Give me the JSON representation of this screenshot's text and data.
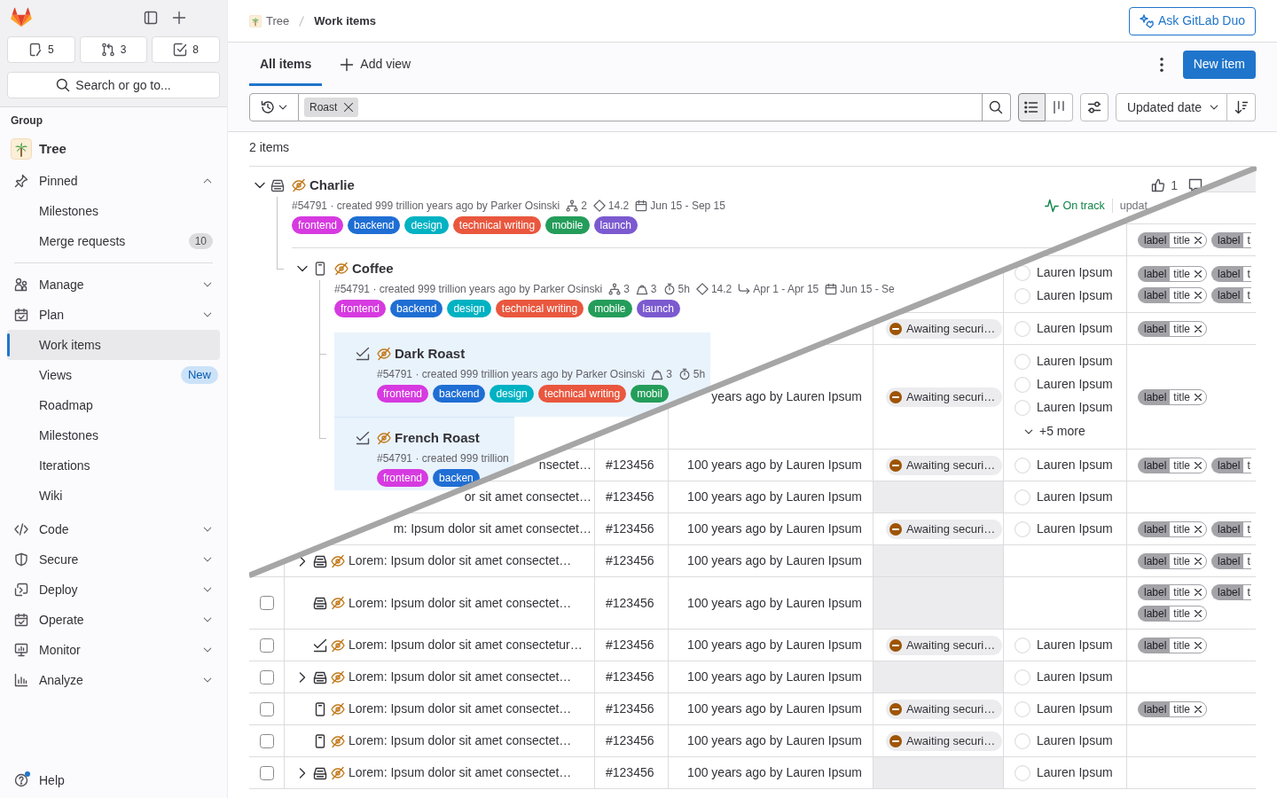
{
  "sidebar": {
    "counters": [
      {
        "kind": "issues",
        "count": "5"
      },
      {
        "kind": "merge_requests",
        "count": "3"
      },
      {
        "kind": "todos",
        "count": "8"
      }
    ],
    "search_button": "Search or go to...",
    "context_heading": "Group",
    "context": "Tree",
    "nav": [
      {
        "kind": "pinned",
        "label": "Pinned",
        "expanded": true,
        "items": [
          {
            "label": "Milestones",
            "selected": false
          },
          {
            "label": "Merge requests",
            "count": "10",
            "selected": false
          }
        ]
      },
      {
        "kind": "manage",
        "label": "Manage",
        "expanded": false
      },
      {
        "kind": "plan",
        "label": "Plan",
        "expanded": false,
        "items": [
          {
            "label": "Work items",
            "selected": true
          },
          {
            "label": "Views",
            "badge": "New",
            "selected": false
          },
          {
            "label": "Roadmap",
            "selected": false
          },
          {
            "label": "Milestones",
            "selected": false
          },
          {
            "label": "Iterations",
            "selected": false
          },
          {
            "label": "Wiki",
            "selected": false
          }
        ]
      },
      {
        "kind": "code",
        "label": "Code",
        "expanded": false
      },
      {
        "kind": "secure",
        "label": "Secure",
        "expanded": false
      },
      {
        "kind": "deploy",
        "label": "Deploy",
        "expanded": false
      },
      {
        "kind": "operate",
        "label": "Operate",
        "expanded": false
      },
      {
        "kind": "monitor",
        "label": "Monitor",
        "expanded": false
      },
      {
        "kind": "analyze",
        "label": "Analyze",
        "expanded": false
      }
    ],
    "help": {
      "label": "Help",
      "unread": true
    }
  },
  "header": {
    "breadcrumb": [
      {
        "kind": "group",
        "label": "Tree",
        "current": false
      },
      {
        "kind": "page",
        "label": "Work items",
        "current": true
      }
    ],
    "duo_button": "Ask GitLab Duo"
  },
  "tabs": [
    {
      "label": "All items",
      "selected": true
    }
  ],
  "add_view": "Add view",
  "new_button": "New item",
  "filter": {
    "token": "Roast"
  },
  "view_toggle": [
    {
      "kind": "list",
      "selected": true
    },
    {
      "kind": "board",
      "selected": false
    }
  ],
  "sort": {
    "label": "Updated date"
  },
  "count": "2 items",
  "list": [
    {
      "kind": "epic",
      "title": "Charlie",
      "confidential": true,
      "expanded": true,
      "selected": false,
      "meta": "#54791 · created 999 trillion years ago by Parker Osinski",
      "stats": [
        {
          "kind": "children",
          "text": "2"
        },
        {
          "kind": "milestone",
          "text": "14.2"
        },
        {
          "kind": "dates",
          "text": "Jun 15 - Sep 15"
        }
      ],
      "labels": [
        {
          "text": "frontend",
          "color": "#d63ae0"
        },
        {
          "text": "backend",
          "color": "#1f6ed4"
        },
        {
          "text": "design",
          "color": "#00b2c2"
        },
        {
          "text": "technical writing",
          "color": "#e9573e"
        },
        {
          "text": "mobile",
          "color": "#249d5a"
        },
        {
          "text": "launch",
          "color": "#7b5ad0"
        }
      ],
      "upvotes": "1",
      "health": "On track",
      "updated": "updat",
      "children": [
        {
          "kind": "issue",
          "title": "Coffee",
          "confidential": true,
          "expanded": true,
          "selected": false,
          "meta": "#54791 · created 999 trillion years ago by Parker Osinski",
          "stats": [
            {
              "kind": "children",
              "text": "3"
            },
            {
              "kind": "weight",
              "text": "3"
            },
            {
              "kind": "time",
              "text": "5h"
            },
            {
              "kind": "milestone",
              "text": "14.2"
            },
            {
              "kind": "iteration",
              "text": "Apr 1 - Apr 15"
            },
            {
              "kind": "dates",
              "text": "Jun 15 - Se"
            }
          ],
          "labels": [
            {
              "text": "frontend",
              "color": "#d63ae0"
            },
            {
              "text": "backend",
              "color": "#1f6ed4"
            },
            {
              "text": "design",
              "color": "#00b2c2"
            },
            {
              "text": "technical writing",
              "color": "#e9573e"
            },
            {
              "text": "mobile",
              "color": "#249d5a"
            },
            {
              "text": "launch",
              "color": "#7b5ad0"
            }
          ],
          "children": [
            {
              "kind": "task",
              "title": "Dark Roast",
              "confidential": true,
              "selected": true,
              "meta": "#54791 · created 999 trillion years ago by Parker Osinski",
              "stats": [
                {
                  "kind": "weight",
                  "text": "3"
                },
                {
                  "kind": "time",
                  "text": "5h"
                }
              ],
              "labels": [
                {
                  "text": "frontend",
                  "color": "#d63ae0"
                },
                {
                  "text": "backend",
                  "color": "#1f6ed4"
                },
                {
                  "text": "design",
                  "color": "#00b2c2"
                },
                {
                  "text": "technical writing",
                  "color": "#e9573e"
                },
                {
                  "text": "mobil",
                  "color": "#249d5a"
                }
              ]
            },
            {
              "kind": "task",
              "title": "French Roast",
              "confidential": true,
              "selected": true,
              "meta": "#54791 · created 999 trillion",
              "labels": [
                {
                  "text": "frontend",
                  "color": "#d63ae0"
                },
                {
                  "text": "backen",
                  "color": "#1f6ed4"
                }
              ]
            }
          ]
        }
      ]
    }
  ],
  "table": {
    "rows": [
      {
        "labels": [
          [
            {
              "key": "label",
              "value": "title",
              "removable": true
            },
            {
              "key": "label",
              "value": "t",
              "removable": false
            }
          ]
        ]
      },
      {
        "assignees": [
          "Lauren Ipsum",
          "Lauren Ipsum"
        ],
        "labels": [
          [
            {
              "key": "label",
              "value": "title",
              "removable": true
            },
            {
              "key": "label",
              "value": "t",
              "removable": false
            }
          ],
          [
            {
              "key": "label",
              "value": "title",
              "removable": true
            },
            {
              "key": "label",
              "value": "t",
              "removable": false
            }
          ]
        ]
      },
      {
        "status": "Awaiting securi…",
        "assignees": [
          "Lauren Ipsum"
        ],
        "labels": [
          [
            {
              "key": "label",
              "value": "title",
              "removable": true
            }
          ]
        ]
      },
      {
        "created": "years ago by Lauren Ipsum",
        "status": "Awaiting securi…",
        "assignees": [
          "Lauren Ipsum",
          "Lauren Ipsum",
          "Lauren Ipsum"
        ],
        "more": "+5 more",
        "labels": [
          [
            {
              "key": "label",
              "value": "title",
              "removable": true
            }
          ]
        ]
      },
      {
        "title": "nsectet…",
        "id": "#123456",
        "created": "100 years ago by Lauren Ipsum",
        "status": "Awaiting securi…",
        "assignees": [
          "Lauren Ipsum"
        ],
        "labels": [
          [
            {
              "key": "label",
              "value": "title",
              "removable": true
            },
            {
              "key": "label",
              "value": "t",
              "removable": false
            }
          ]
        ]
      },
      {
        "title": "or sit amet consectet…",
        "id": "#123456",
        "created": "100 years ago by Lauren Ipsum",
        "assignees": [
          "Lauren Ipsum"
        ]
      },
      {
        "title": "m: Ipsum dolor sit amet consectet…",
        "id": "#123456",
        "created": "100 years ago by Lauren Ipsum",
        "status": "Awaiting securi…",
        "assignees": [
          "Lauren Ipsum"
        ],
        "labels": [
          [
            {
              "key": "label",
              "value": "title",
              "removable": true
            },
            {
              "key": "label",
              "value": "t",
              "removable": false
            }
          ]
        ]
      },
      {
        "kind": "epic",
        "expanded": false,
        "confidential": true,
        "title": "Lorem: Ipsum dolor sit amet consectet…",
        "id": "#123456",
        "created": "100 years ago by Lauren Ipsum",
        "labels": [
          [
            {
              "key": "label",
              "value": "title",
              "removable": true
            },
            {
              "key": "label",
              "value": "t",
              "removable": false
            }
          ]
        ]
      },
      {
        "checked": false,
        "kind": "epic",
        "confidential": true,
        "title": "Lorem: Ipsum dolor sit amet consectet…",
        "id": "#123456",
        "created": "100 years ago by Lauren Ipsum",
        "labels": [
          [
            {
              "key": "label",
              "value": "title",
              "removable": true
            },
            {
              "key": "label",
              "value": "t",
              "removable": false
            }
          ],
          [
            {
              "key": "label",
              "value": "title",
              "removable": true
            }
          ]
        ]
      },
      {
        "checked": false,
        "kind": "task",
        "confidential": true,
        "title": "Lorem: Ipsum dolor sit amet consectetur…",
        "id": "#123456",
        "created": "100 years ago by Lauren Ipsum",
        "status": "Awaiting securi…",
        "assignees": [
          "Lauren Ipsum"
        ],
        "labels": [
          [
            {
              "key": "label",
              "value": "title",
              "removable": true
            }
          ]
        ]
      },
      {
        "checked": false,
        "kind": "epic",
        "expanded": false,
        "confidential": true,
        "title": "Lorem: Ipsum dolor sit amet consectet…",
        "id": "#123456",
        "created": "100 years ago by Lauren Ipsum",
        "assignees": [
          "Lauren Ipsum"
        ]
      },
      {
        "checked": false,
        "kind": "issue",
        "confidential": true,
        "title": "Lorem: Ipsum dolor sit amet consectet…",
        "id": "#123456",
        "created": "100 years ago by Lauren Ipsum",
        "status": "Awaiting securi…",
        "assignees": [
          "Lauren Ipsum"
        ],
        "labels": [
          [
            {
              "key": "label",
              "value": "title",
              "removable": true
            }
          ]
        ]
      },
      {
        "checked": false,
        "kind": "issue",
        "confidential": true,
        "title": "Lorem: Ipsum dolor sit amet consectet…",
        "id": "#123456",
        "created": "100 years ago by Lauren Ipsum",
        "status": "Awaiting securi…",
        "assignees": [
          "Lauren Ipsum"
        ]
      },
      {
        "checked": false,
        "kind": "epic",
        "expanded": false,
        "confidential": true,
        "title": "Lorem: Ipsum dolor sit amet consectet…",
        "id": "#123456",
        "created": "100 years ago by Lauren Ipsum",
        "assignees": [
          "Lauren Ipsum"
        ]
      }
    ]
  }
}
